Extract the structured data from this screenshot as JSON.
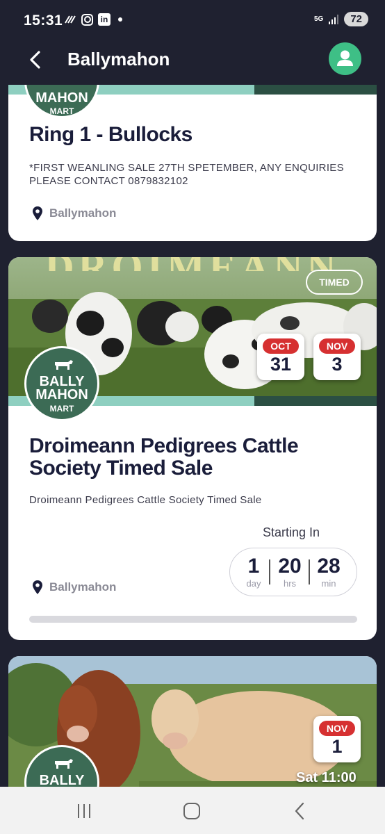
{
  "status_bar": {
    "time": "15:31",
    "network": "5G",
    "battery": "72",
    "icons": [
      "signal-waves-icon",
      "instagram-icon",
      "linkedin-icon",
      "notification-dot-icon",
      "network-5g-icon",
      "signal-strength-icon",
      "battery-icon"
    ]
  },
  "header": {
    "title": "Ballymahon",
    "back_icon": "back-arrow-icon",
    "avatar_icon": "user-icon",
    "accent_color": "#3ebf86"
  },
  "logo": {
    "line1": "BALLY",
    "line2": "MAHON",
    "line3": "MART",
    "partial_top": "MAHON"
  },
  "cards": [
    {
      "title": "Ring 1 - Bullocks",
      "description": "*FIRST WEANLING SALE 27TH SPETEMBER, ANY ENQUIRIES PLEASE CONTACT 0879832102",
      "location": "Ballymahon"
    },
    {
      "banner_text": "DROIMEANN",
      "badge": "TIMED",
      "start_date": {
        "month": "OCT",
        "day": "31"
      },
      "end_date": {
        "month": "NOV",
        "day": "3"
      },
      "title": "Droimeann Pedigrees Cattle Society Timed Sale",
      "description": "Droimeann Pedigrees Cattle Society Timed Sale",
      "starting_in_label": "Starting In",
      "countdown": [
        {
          "value": "1",
          "unit": "day"
        },
        {
          "value": "20",
          "unit": "hrs"
        },
        {
          "value": "28",
          "unit": "min"
        }
      ],
      "location": "Ballymahon",
      "progress": 0
    },
    {
      "date": {
        "month": "NOV",
        "day": "1"
      },
      "time_label": "Sat 11:00"
    }
  ],
  "colors": {
    "dark_bg": "#1f2130",
    "date_red": "#d63031",
    "stripe_light": "#8ecfc0",
    "stripe_dark": "#2b4f43",
    "logo_green": "#3c6b55"
  },
  "nav": {
    "icons": [
      "recent-apps-icon",
      "home-icon",
      "back-icon"
    ]
  }
}
